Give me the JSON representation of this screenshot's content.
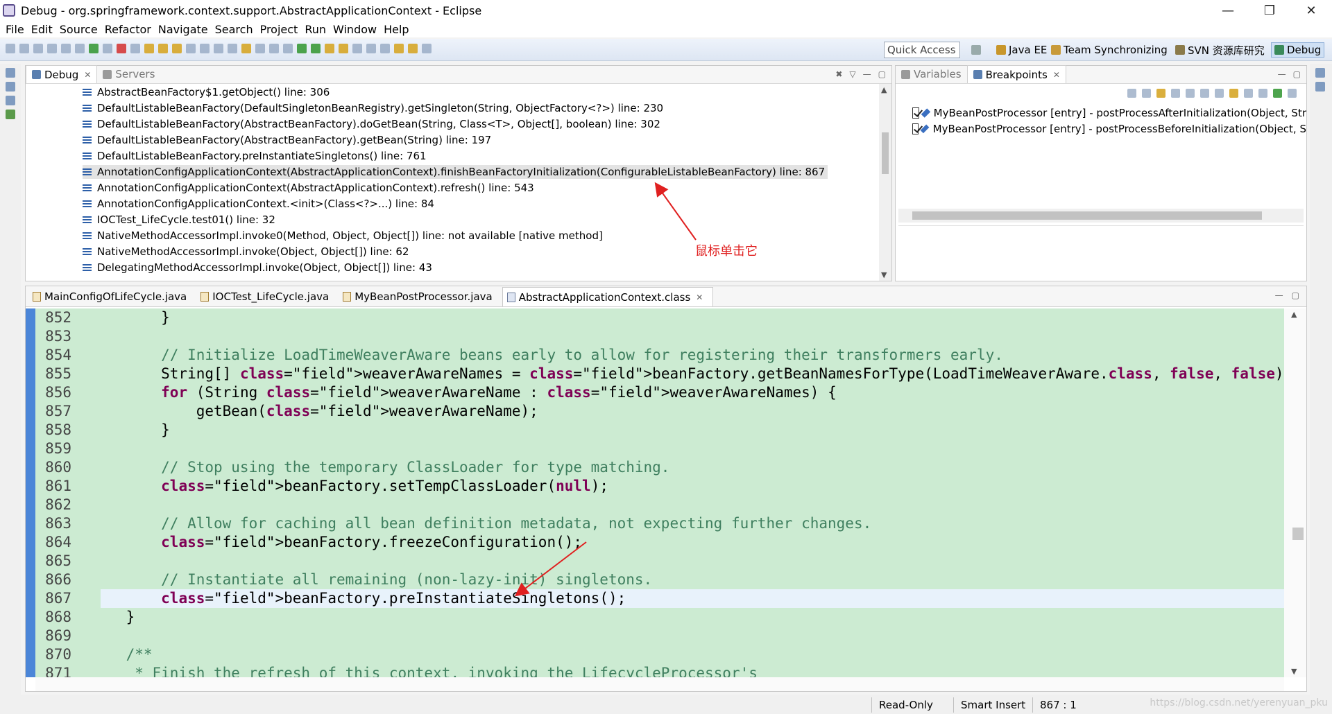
{
  "window": {
    "title": "Debug - org.springframework.context.support.AbstractApplicationContext - Eclipse",
    "minimize": "—",
    "restore": "❐",
    "close": "✕"
  },
  "menu": [
    "File",
    "Edit",
    "Source",
    "Refactor",
    "Navigate",
    "Search",
    "Project",
    "Run",
    "Window",
    "Help"
  ],
  "toolbar": {
    "quick_access": "Quick Access",
    "perspectives": [
      {
        "label": "Java EE",
        "icon": "java-ee-perspective-icon"
      },
      {
        "label": "Team Synchronizing",
        "icon": "team-sync-perspective-icon"
      },
      {
        "label": "SVN 资源库研究",
        "icon": "svn-perspective-icon"
      },
      {
        "label": "Debug",
        "icon": "debug-perspective-icon"
      }
    ]
  },
  "debug_view": {
    "tabs": [
      {
        "label": "Debug",
        "active": true
      },
      {
        "label": "Servers",
        "active": false
      }
    ],
    "frames": [
      "AbstractBeanFactory$1.getObject() line: 306",
      "DefaultListableBeanFactory(DefaultSingletonBeanRegistry).getSingleton(String, ObjectFactory<?>) line: 230",
      "DefaultListableBeanFactory(AbstractBeanFactory).doGetBean(String, Class<T>, Object[], boolean) line: 302",
      "DefaultListableBeanFactory(AbstractBeanFactory).getBean(String) line: 197",
      "DefaultListableBeanFactory.preInstantiateSingletons() line: 761",
      "AnnotationConfigApplicationContext(AbstractApplicationContext).finishBeanFactoryInitialization(ConfigurableListableBeanFactory) line: 867",
      "AnnotationConfigApplicationContext(AbstractApplicationContext).refresh() line: 543",
      "AnnotationConfigApplicationContext.<init>(Class<?>...) line: 84",
      "IOCTest_LifeCycle.test01() line: 32",
      "NativeMethodAccessorImpl.invoke0(Method, Object, Object[]) line: not available [native method]",
      "NativeMethodAccessorImpl.invoke(Object, Object[]) line: 62",
      "DelegatingMethodAccessorImpl.invoke(Object, Object[]) line: 43"
    ],
    "selected_index": 5,
    "annotation": "鼠标单击它"
  },
  "breakpoints_view": {
    "tabs": [
      {
        "label": "Variables",
        "active": false
      },
      {
        "label": "Breakpoints",
        "active": true
      }
    ],
    "items": [
      "MyBeanPostProcessor [entry] - postProcessAfterInitialization(Object, Str",
      "MyBeanPostProcessor [entry] - postProcessBeforeInitialization(Object, S"
    ]
  },
  "editor": {
    "tabs": [
      {
        "label": "MainConfigOfLifeCycle.java",
        "active": false
      },
      {
        "label": "IOCTest_LifeCycle.java",
        "active": false
      },
      {
        "label": "MyBeanPostProcessor.java",
        "active": false
      },
      {
        "label": "AbstractApplicationContext.class",
        "active": true
      }
    ],
    "current_line": 867,
    "lines": [
      {
        "n": "852",
        "code": "        }"
      },
      {
        "n": "853",
        "code": ""
      },
      {
        "n": "854",
        "code": "        // Initialize LoadTimeWeaverAware beans early to allow for registering their transformers early."
      },
      {
        "n": "855",
        "code": "        String[] weaverAwareNames = beanFactory.getBeanNamesForType(LoadTimeWeaverAware.class, false, false);"
      },
      {
        "n": "856",
        "code": "        for (String weaverAwareName : weaverAwareNames) {"
      },
      {
        "n": "857",
        "code": "            getBean(weaverAwareName);"
      },
      {
        "n": "858",
        "code": "        }"
      },
      {
        "n": "859",
        "code": ""
      },
      {
        "n": "860",
        "code": "        // Stop using the temporary ClassLoader for type matching."
      },
      {
        "n": "861",
        "code": "        beanFactory.setTempClassLoader(null);"
      },
      {
        "n": "862",
        "code": ""
      },
      {
        "n": "863",
        "code": "        // Allow for caching all bean definition metadata, not expecting further changes."
      },
      {
        "n": "864",
        "code": "        beanFactory.freezeConfiguration();"
      },
      {
        "n": "865",
        "code": ""
      },
      {
        "n": "866",
        "code": "        // Instantiate all remaining (non-lazy-init) singletons."
      },
      {
        "n": "867",
        "code": "        beanFactory.preInstantiateSingletons();"
      },
      {
        "n": "868",
        "code": "    }"
      },
      {
        "n": "869",
        "code": ""
      },
      {
        "n": "870",
        "code": "    /**"
      },
      {
        "n": "871",
        "code": "     * Finish the refresh of this context, invoking the LifecycleProcessor's"
      }
    ]
  },
  "status": {
    "mode": "Read-Only",
    "insert": "Smart Insert",
    "position": "867 : 1",
    "watermark": "https://blog.csdn.net/yerenyuan_pku"
  },
  "colors": {
    "code_bg": "#ccebd2",
    "comment": "#3f7f5f",
    "keyword": "#7f0055",
    "field": "#0000c0",
    "annotation_red": "#e02020"
  }
}
